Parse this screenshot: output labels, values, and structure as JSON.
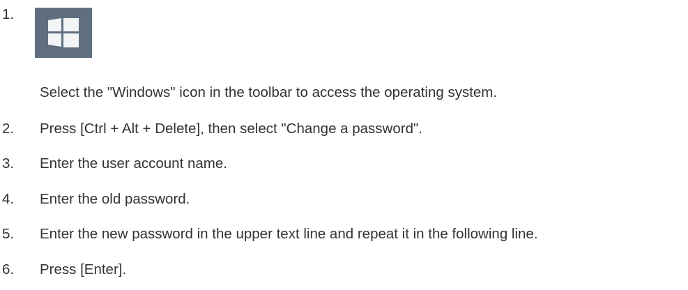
{
  "steps": [
    {
      "number": "1.",
      "text": "Select the \"Windows\" icon in the toolbar to access the operating system.",
      "icon": "windows-start-icon"
    },
    {
      "number": "2.",
      "text": "Press [Ctrl  + Alt + Delete], then select \"Change a password\"."
    },
    {
      "number": "3.",
      "text": "Enter the user account name."
    },
    {
      "number": "4.",
      "text": "Enter the old password."
    },
    {
      "number": "5.",
      "text": "Enter the new password in the upper text line and repeat it in the following line."
    },
    {
      "number": "6.",
      "text": "Press [Enter]."
    }
  ],
  "colors": {
    "text": "#333333",
    "icon_tile": "#5f6f7f",
    "icon_glyph": "#f2f4f6"
  }
}
